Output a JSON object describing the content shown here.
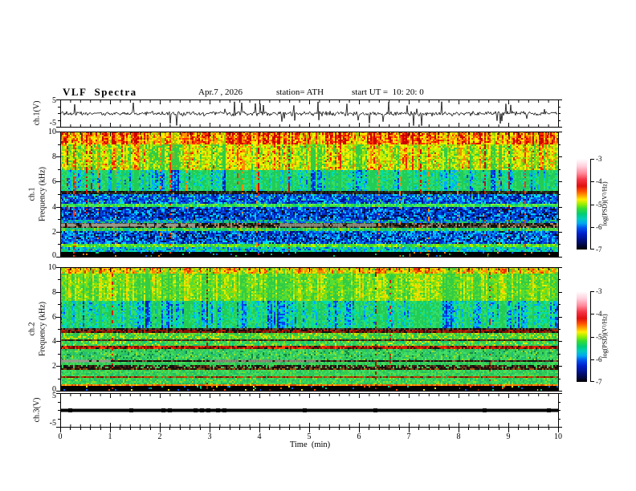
{
  "header": {
    "title": "VLF  Spectra",
    "date": "Apr.7 , 2026",
    "station": "station= ATH",
    "start_ut": "start UT =  10: 20: 0"
  },
  "chart_data": {
    "type": "heatmap",
    "description": "VLF receiver quick-look: ch.1 voltage waveform, ch.1 and ch.2 power spectrograms (0-10 kHz) over 10 minutes, ch.3 flat voltage trace",
    "time_axis": {
      "label": "Time  (min)",
      "min": 0,
      "max": 10,
      "major_ticks": [
        0,
        1,
        2,
        3,
        4,
        5,
        6,
        7,
        8,
        9,
        10
      ],
      "minor_step": 0.2
    },
    "colorbar": {
      "label": "log(PSD)(V²/Hz)",
      "max": -3,
      "min": -7,
      "ticks": [
        -3,
        -4,
        -5,
        -6,
        -7
      ],
      "stops": [
        [
          0,
          "#ffffff"
        ],
        [
          0.08,
          "#ffd0dd"
        ],
        [
          0.16,
          "#ff8899"
        ],
        [
          0.23,
          "#f43344"
        ],
        [
          0.3,
          "#e01010"
        ],
        [
          0.36,
          "#ff5500"
        ],
        [
          0.41,
          "#ffaa00"
        ],
        [
          0.45,
          "#ffee00"
        ],
        [
          0.5,
          "#99ee00"
        ],
        [
          0.55,
          "#33dd33"
        ],
        [
          0.61,
          "#00cc77"
        ],
        [
          0.66,
          "#00ccbb"
        ],
        [
          0.71,
          "#00aaee"
        ],
        [
          0.76,
          "#0055ee"
        ],
        [
          0.82,
          "#0022cc"
        ],
        [
          0.89,
          "#001188"
        ],
        [
          0.95,
          "#000744"
        ],
        [
          1,
          "#000000"
        ]
      ]
    },
    "panels": [
      {
        "id": "ch1-waveform",
        "kind": "waveform",
        "channel": "ch.1(V)",
        "ylim": [
          -5,
          5
        ],
        "y_ticks": [
          5,
          -5
        ],
        "baseline": 0,
        "typical_amplitude_v": 1,
        "spike_amplitude_v": 5,
        "spike_rate": 0.05
      },
      {
        "id": "ch1-spectrogram",
        "kind": "spectrogram",
        "channel": "ch.1",
        "ylabel": "Frequency  (kHz)",
        "freq_lim": [
          0,
          10
        ],
        "freq_ticks": [
          10,
          8,
          6,
          4,
          2,
          0
        ],
        "bands": [
          {
            "f": [
              9.0,
              10.0
            ],
            "m": "col_hot",
            "p": [
              "#99cc00",
              "#ddee00",
              "#ffee00",
              "#ff9900",
              "#ff3300",
              "#cc0000"
            ],
            "b": 0.18
          },
          {
            "f": [
              7.0,
              9.0
            ],
            "m": "col_hot",
            "p": [
              "#33cc44",
              "#88dd11",
              "#ccee00",
              "#ffee00",
              "#ff8800",
              "#ee2200"
            ],
            "b": -0.05
          },
          {
            "f": [
              5.25,
              7.0
            ],
            "m": "col_cool",
            "p": [
              "#22cc55",
              "#33dd66",
              "#00ddaa",
              "#00aaff",
              "#0044ee",
              "#0022aa"
            ],
            "b": 0
          },
          {
            "f": [
              5.05,
              5.25
            ],
            "m": "rand",
            "p": [
              "#111111",
              "#333322",
              "#556633",
              "#222222"
            ],
            "w": [
              3,
              2,
              1,
              2
            ]
          },
          {
            "f": [
              4.25,
              5.05
            ],
            "m": "rand",
            "p": [
              "#0033cc",
              "#0055ee",
              "#0099ff",
              "#00ddee",
              "#001188",
              "#33cc66"
            ],
            "w": [
              3,
              3,
              2,
              2,
              2,
              1
            ]
          },
          {
            "f": [
              3.95,
              4.25
            ],
            "m": "rand",
            "p": [
              "#33dd44",
              "#55ee55",
              "#aaee00",
              "#00cc88"
            ],
            "w": [
              4,
              3,
              1,
              2
            ]
          },
          {
            "f": [
              3.0,
              3.95
            ],
            "m": "rand",
            "p": [
              "#0022bb",
              "#0044dd",
              "#0077ff",
              "#00ccff",
              "#000d66",
              "#111111"
            ],
            "w": [
              3,
              3,
              2,
              2,
              2,
              1
            ]
          },
          {
            "f": [
              2.75,
              3.0
            ],
            "m": "rand",
            "p": [
              "#0044dd",
              "#00bbaa",
              "#22cc55",
              "#0077ff"
            ],
            "w": [
              2,
              2,
              2,
              2
            ]
          },
          {
            "f": [
              2.35,
              2.75
            ],
            "m": "rand",
            "p": [
              "#111111",
              "#443322",
              "#665544",
              "#998877",
              "#bb8855"
            ],
            "w": [
              4,
              2,
              2,
              1,
              1
            ]
          },
          {
            "f": [
              2.15,
              2.35
            ],
            "m": "rand",
            "p": [
              "#22cc55",
              "#55dd44",
              "#00bbaa",
              "#99dd00"
            ],
            "w": [
              3,
              2,
              2,
              1
            ]
          },
          {
            "f": [
              1.1,
              2.15
            ],
            "m": "rand",
            "p": [
              "#0033cc",
              "#0066ee",
              "#00aaff",
              "#00ddee",
              "#000d77",
              "#111111"
            ],
            "w": [
              3,
              3,
              2,
              2,
              2,
              1
            ]
          },
          {
            "f": [
              0.85,
              1.1
            ],
            "m": "rand",
            "p": [
              "#44dd33",
              "#88ee00",
              "#ccee00",
              "#22cc66"
            ],
            "w": [
              3,
              2,
              1,
              2
            ]
          },
          {
            "f": [
              0.5,
              0.85
            ],
            "m": "rand",
            "p": [
              "#00ccaa",
              "#00ddcc",
              "#0088ff",
              "#22cc55",
              "#0044cc"
            ],
            "w": [
              3,
              2,
              2,
              2,
              1
            ]
          },
          {
            "f": [
              0.0,
              0.5
            ],
            "m": "solid",
            "p": [
              "#000000",
              "#00cc88",
              "#0066ff",
              "#22dd33",
              "#ff8800"
            ],
            "sp": 0.05
          }
        ],
        "overlays": [
          {
            "f": [
              2.45,
              2.7
            ],
            "x": [
              0.0,
              0.27
            ],
            "c": "#99998a"
          },
          {
            "f": [
              2.45,
              2.7
            ],
            "x": [
              0.44,
              0.63
            ],
            "c": "#8a8a7a"
          }
        ],
        "streaks": {
          "count": 26,
          "palette": [
            "#ff3300",
            "#ff8800",
            "#cc1100"
          ],
          "p_hi": 0.55,
          "p_lo": 0.16
        }
      },
      {
        "id": "ch2-spectrogram",
        "kind": "spectrogram",
        "channel": "ch.2",
        "ylabel": "Frequency  (kHz)",
        "freq_lim": [
          0,
          10
        ],
        "freq_ticks": [
          10,
          8,
          6,
          4,
          2,
          0
        ],
        "bands": [
          {
            "f": [
              9.5,
              10.0
            ],
            "m": "col_hot",
            "p": [
              "#55cc33",
              "#aadd00",
              "#ffdd00",
              "#ff8800",
              "#ee3300"
            ],
            "b": 0.1
          },
          {
            "f": [
              7.3,
              9.5
            ],
            "m": "col_hot",
            "p": [
              "#33cc44",
              "#55dd33",
              "#99dd00",
              "#ddee00",
              "#ffcc00"
            ],
            "b": -0.05
          },
          {
            "f": [
              5.1,
              7.3
            ],
            "m": "col_cool",
            "p": [
              "#22cc55",
              "#33dd66",
              "#00ddaa",
              "#00aaff",
              "#0044ee",
              "#0022bb"
            ],
            "b": 0.02
          },
          {
            "f": [
              4.95,
              5.1
            ],
            "m": "rand",
            "p": [
              "#111111",
              "#444433",
              "#665533"
            ],
            "w": [
              3,
              2,
              1
            ]
          },
          {
            "f": [
              4.75,
              4.95
            ],
            "m": "rand",
            "p": [
              "#881100",
              "#bb2200",
              "#111111",
              "#664422"
            ],
            "w": [
              3,
              2,
              3,
              1
            ]
          },
          {
            "f": [
              4.25,
              4.75
            ],
            "m": "rand",
            "p": [
              "#33cc44",
              "#66dd33",
              "#bbdd00",
              "#eedd00",
              "#22bb66"
            ],
            "w": [
              4,
              3,
              2,
              1,
              2
            ]
          },
          {
            "f": [
              4.1,
              4.25
            ],
            "m": "rand",
            "p": [
              "#222211",
              "#553311",
              "#775522"
            ],
            "w": [
              2,
              2,
              1
            ]
          },
          {
            "f": [
              3.65,
              4.1
            ],
            "m": "rand",
            "p": [
              "#33cc55",
              "#44dd55",
              "#88dd22",
              "#ddee00",
              "#00cc88"
            ],
            "w": [
              4,
              3,
              2,
              1,
              2
            ]
          },
          {
            "f": [
              3.45,
              3.65
            ],
            "m": "rand",
            "p": [
              "#cc2200",
              "#881100",
              "#ff4400",
              "#331100",
              "#111111"
            ],
            "w": [
              4,
              3,
              2,
              1,
              1
            ]
          },
          {
            "f": [
              2.55,
              3.45
            ],
            "m": "rand",
            "p": [
              "#33cc55",
              "#44dd66",
              "#22bb77",
              "#99dd22",
              "#118844"
            ],
            "w": [
              4,
              3,
              2,
              1,
              1
            ]
          },
          {
            "f": [
              2.35,
              2.55
            ],
            "m": "rand",
            "p": [
              "#221100",
              "#553322",
              "#886644",
              "#111111"
            ],
            "w": [
              3,
              2,
              1,
              3
            ]
          },
          {
            "f": [
              2.1,
              2.35
            ],
            "m": "rand",
            "p": [
              "#33cc55",
              "#44dd55",
              "#22bb66"
            ],
            "w": [
              3,
              3,
              2
            ]
          },
          {
            "f": [
              1.85,
              2.1
            ],
            "m": "rand",
            "p": [
              "#111111",
              "#442211",
              "#664422",
              "#33cc55"
            ],
            "w": [
              3,
              2,
              1,
              2
            ]
          },
          {
            "f": [
              1.7,
              1.85
            ],
            "m": "rand",
            "p": [
              "#331100",
              "#774411",
              "#aa5511",
              "#111111"
            ],
            "w": [
              2,
              2,
              1,
              2
            ]
          },
          {
            "f": [
              1.25,
              1.7
            ],
            "m": "rand",
            "p": [
              "#33cc55",
              "#44dd66",
              "#22bb66",
              "#66dd33"
            ],
            "w": [
              4,
              3,
              2,
              1
            ]
          },
          {
            "f": [
              1.05,
              1.25
            ],
            "m": "rand",
            "p": [
              "#aa3300",
              "#cc4400",
              "#771100",
              "#33aa44"
            ],
            "w": [
              3,
              2,
              2,
              1
            ]
          },
          {
            "f": [
              0.62,
              1.05
            ],
            "m": "rand",
            "p": [
              "#33cc55",
              "#44dd55",
              "#22bb66",
              "#99dd22"
            ],
            "w": [
              3,
              3,
              2,
              1
            ]
          },
          {
            "f": [
              0.45,
              0.62
            ],
            "m": "rand",
            "p": [
              "#ff7700",
              "#ff9900",
              "#dd4400",
              "#ffcc00"
            ],
            "w": [
              3,
              2,
              2,
              1
            ]
          },
          {
            "f": [
              0.0,
              0.45
            ],
            "m": "solid",
            "p": [
              "#000000",
              "#00cc88",
              "#ff5500",
              "#0066ff",
              "#ffee00"
            ],
            "sp": 0.07
          }
        ],
        "overlays": [
          {
            "f": [
              2.35,
              2.55
            ],
            "x": [
              0.0,
              0.1
            ],
            "c": "#99998a"
          },
          {
            "f": [
              2.35,
              2.55
            ],
            "x": [
              0.3,
              0.52
            ],
            "c": "#8a8a7a"
          }
        ],
        "streaks": {
          "count": 5,
          "palette": [
            "#cc2200",
            "#992200"
          ],
          "p_hi": 0.3,
          "p_lo": 0.25
        }
      },
      {
        "id": "ch3-waveform",
        "kind": "flatline",
        "channel": "ch.3(V)",
        "ylim": [
          -5,
          5
        ],
        "y_ticks": [
          5,
          -5
        ],
        "value": 0
      }
    ]
  }
}
